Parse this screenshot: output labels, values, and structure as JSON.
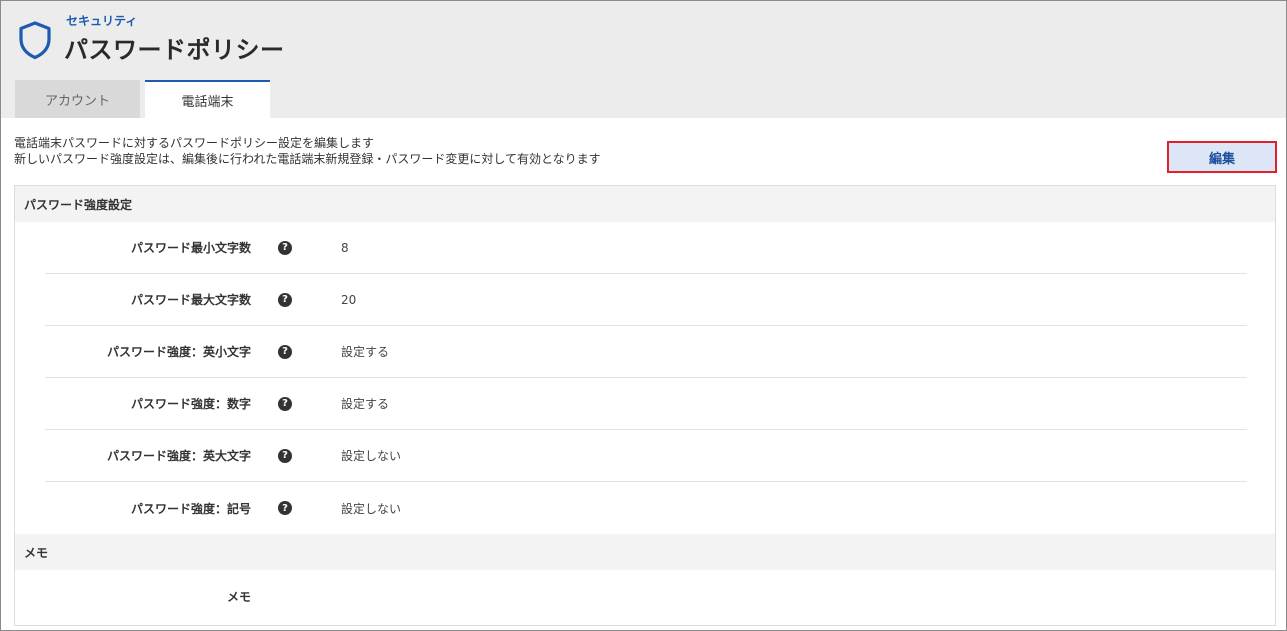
{
  "header": {
    "subtitle": "セキュリティ",
    "title": "パスワードポリシー",
    "icon": "shield-icon",
    "accent_color": "#1d5bb0"
  },
  "tabs": [
    {
      "label": "アカウント",
      "active": false
    },
    {
      "label": "電話端末",
      "active": true
    }
  ],
  "description": {
    "line1": "電話端末パスワードに対するパスワードポリシー設定を編集します",
    "line2": "新しいパスワード強度設定は、編集後に行われた電話端末新規登録・パスワード変更に対して有効となります"
  },
  "edit_button": {
    "label": "編集",
    "border_color": "#e0202a"
  },
  "strength_section": {
    "title": "パスワード強度設定",
    "rows": [
      {
        "label": "パスワード最小文字数",
        "value": "8"
      },
      {
        "label": "パスワード最大文字数",
        "value": "20"
      },
      {
        "label": "パスワード強度：英小文字",
        "value": "設定する"
      },
      {
        "label": "パスワード強度：数字",
        "value": "設定する"
      },
      {
        "label": "パスワード強度：英大文字",
        "value": "設定しない"
      },
      {
        "label": "パスワード強度：記号",
        "value": "設定しない"
      }
    ],
    "help_icon": "question-circle-icon"
  },
  "memo_section": {
    "title": "メモ",
    "rows": [
      {
        "label": "メモ",
        "value": ""
      }
    ]
  }
}
